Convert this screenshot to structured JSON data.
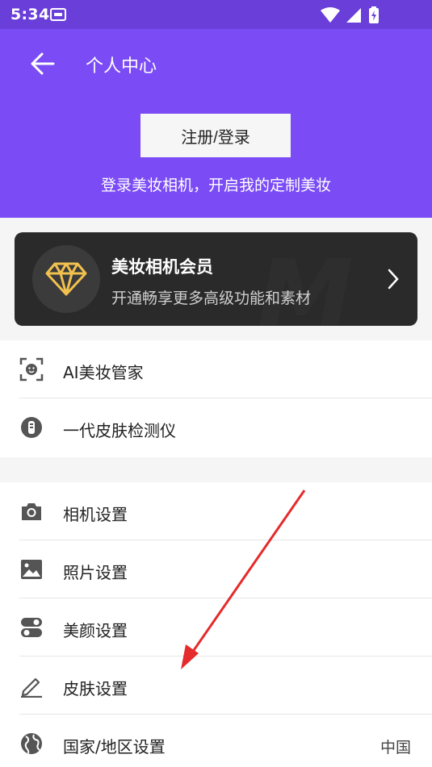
{
  "status_bar": {
    "time": "5:34",
    "notification_icon": "notification-icon",
    "wifi_icon": "wifi-icon",
    "signal_icon": "signal-icon",
    "battery_icon": "battery-charging-icon"
  },
  "header": {
    "title": "个人中心",
    "back_icon": "back-arrow-icon",
    "login_button": "注册/登录",
    "tagline": "登录美妆相机，开启我的定制美妆",
    "background_color": "#7b4cf6"
  },
  "vip_card": {
    "title": "美妆相机会员",
    "subtitle": "开通畅享更多高级功能和素材",
    "icon": "diamond-icon",
    "accent_color": "#f2c14e"
  },
  "section1": {
    "items": [
      {
        "label": "AI美妆管家",
        "icon": "face-scan-icon"
      },
      {
        "label": "一代皮肤检测仪",
        "icon": "skin-device-icon"
      }
    ]
  },
  "section2": {
    "items": [
      {
        "label": "相机设置",
        "icon": "camera-icon"
      },
      {
        "label": "照片设置",
        "icon": "image-icon"
      },
      {
        "label": "美颜设置",
        "icon": "toggle-icon"
      },
      {
        "label": "皮肤设置",
        "icon": "pen-icon"
      },
      {
        "label": "国家/地区设置",
        "icon": "globe-icon",
        "value": "中国"
      }
    ]
  },
  "annotation": {
    "arrow_color": "#e52b2b"
  }
}
